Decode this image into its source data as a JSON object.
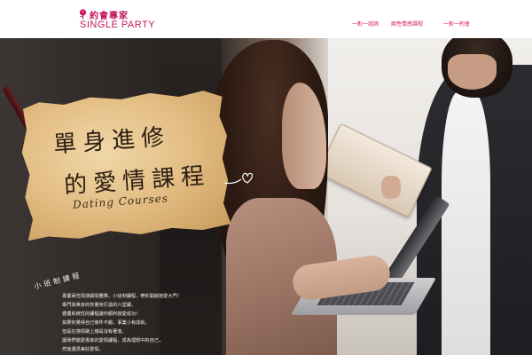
{
  "header": {
    "logo": {
      "chinese": "約會專家",
      "english": "SINGLE PARTY"
    },
    "nav": [
      {
        "label": "一對一諮詢"
      },
      {
        "label": "兩性情感課程"
      },
      {
        "label": "一對一約會"
      }
    ]
  },
  "hero": {
    "paper": {
      "title_line1": "單身進修",
      "title_line2": "的愛情課程",
      "subtitle": "Dating Courses"
    },
    "sub_label": "小班制課程",
    "description": [
      "專業兩性情感顧問團隊，小班制課程，帶你開啟戀愛大門！",
      "專門為單身的你量身打造的六堂課，",
      "循循系統性的課程讓你順利戀愛成功！",
      "如果你覺得自己條件不錯，事業小有成就，",
      "但是在感情路上總是沒有著落，",
      "讓我們戀愛專家的愛情課程，成為理想中的自己，",
      "然後遇見美好愛情。"
    ]
  },
  "colors": {
    "brand": "#c2185b",
    "nav_text": "#d81b60"
  }
}
